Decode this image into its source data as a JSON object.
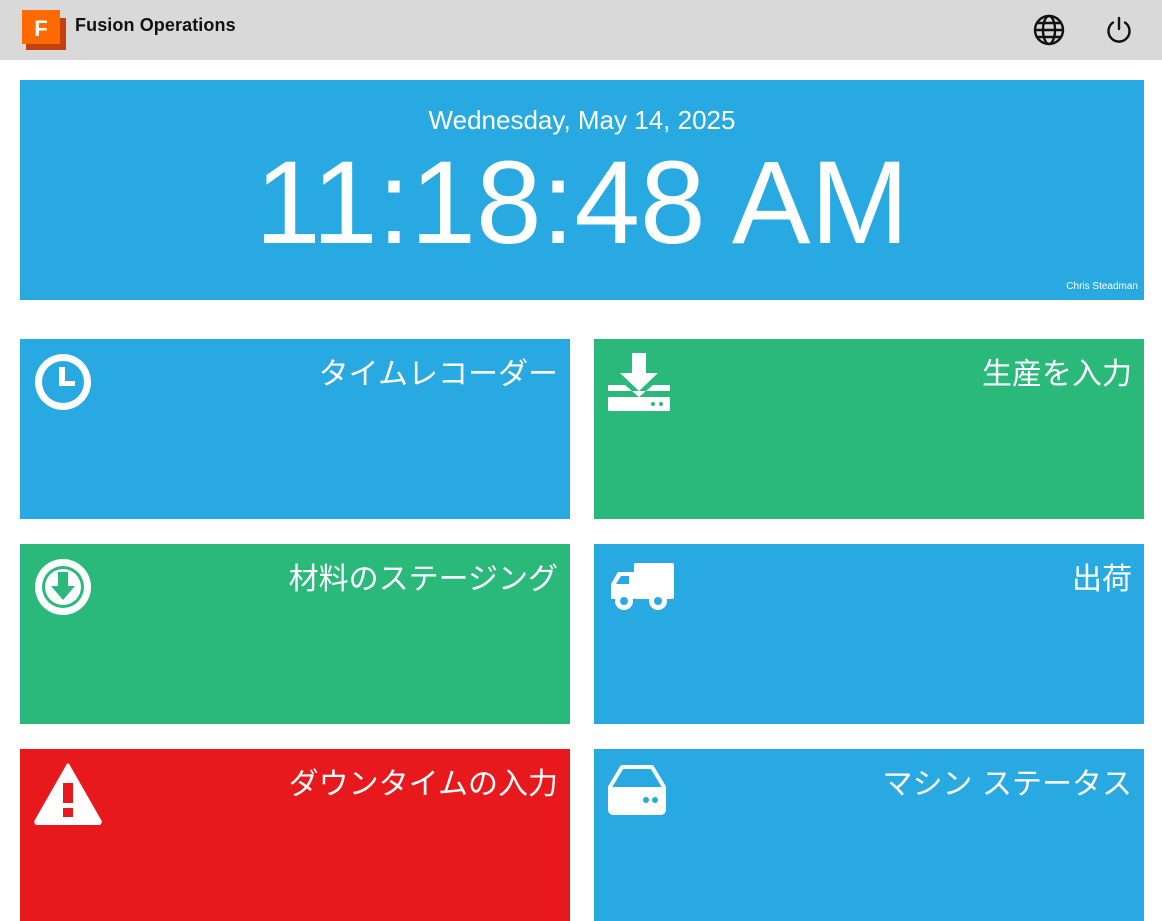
{
  "header": {
    "app_title": "Fusion Operations",
    "logo_letter": "F",
    "logo_colors": {
      "front": "#ff6a00",
      "back": "#c2410c"
    },
    "icons": [
      "globe-icon",
      "power-icon"
    ]
  },
  "clock": {
    "date": "Wednesday, May 14, 2025",
    "time": "11:18:48 AM",
    "user": "Chris Steadman",
    "color": "#29a9e2"
  },
  "tiles": [
    {
      "label": "タイムレコーダー",
      "icon": "clock-icon",
      "color": "#29a9e2"
    },
    {
      "label": "生産を入力",
      "icon": "download-tray-icon",
      "color": "#2ab97a"
    },
    {
      "label": "材料のステージング",
      "icon": "arrow-down-circle-icon",
      "color": "#2ab97a"
    },
    {
      "label": "出荷",
      "icon": "truck-icon",
      "color": "#29a9e2"
    },
    {
      "label": "ダウンタイムの入力",
      "icon": "warning-icon",
      "color": "#e8191c"
    },
    {
      "label": "マシン ステータス",
      "icon": "hard-drive-icon",
      "color": "#29a9e2"
    }
  ]
}
